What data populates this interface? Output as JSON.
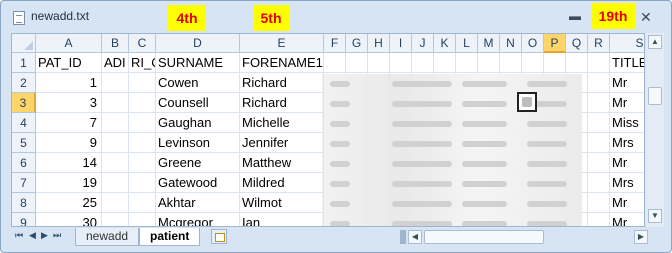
{
  "window": {
    "title": "newadd.txt"
  },
  "annotations": {
    "col4": "4th",
    "col5": "5th",
    "col19": "19th"
  },
  "colors": {
    "highlight": "#ffff00",
    "annotation_text": "#e30000",
    "selected_header": "#ffd56a"
  },
  "icons": {
    "doc": "document-icon",
    "minimize": "minimize-icon",
    "close": "close-icon"
  },
  "columns": [
    "A",
    "B",
    "C",
    "D",
    "E",
    "F",
    "G",
    "H",
    "I",
    "J",
    "K",
    "L",
    "M",
    "N",
    "O",
    "P",
    "Q",
    "R",
    "S"
  ],
  "selected": {
    "column": "P",
    "row": "3"
  },
  "row_numbers": [
    "1",
    "2",
    "3",
    "4",
    "5",
    "6",
    "7",
    "8",
    "9"
  ],
  "rows": [
    {
      "a": "PAT_ID",
      "b": "ADI",
      "c": "RI_C",
      "d": "SURNAME",
      "e": "FORENAME1",
      "s": "TITLE"
    },
    {
      "a": "1",
      "b": "",
      "c": "",
      "d": "Cowen",
      "e": "Richard",
      "s": "Mr"
    },
    {
      "a": "3",
      "b": "",
      "c": "",
      "d": "Counsell",
      "e": "Richard",
      "s": "Mr"
    },
    {
      "a": "7",
      "b": "",
      "c": "",
      "d": "Gaughan",
      "e": "Michelle",
      "s": "Miss"
    },
    {
      "a": "9",
      "b": "",
      "c": "",
      "d": "Levinson",
      "e": "Jennifer",
      "s": "Mrs"
    },
    {
      "a": "14",
      "b": "",
      "c": "",
      "d": "Greene",
      "e": "Matthew",
      "s": "Mr"
    },
    {
      "a": "19",
      "b": "",
      "c": "",
      "d": "Gatewood",
      "e": "Mildred",
      "s": "Mrs"
    },
    {
      "a": "25",
      "b": "",
      "c": "",
      "d": "Akhtar",
      "e": "Wilmot",
      "s": "Mr"
    },
    {
      "a": "30",
      "b": "",
      "c": "",
      "d": "Mcgregor",
      "e": "Ian",
      "s": "Mr"
    }
  ],
  "sheets": {
    "tab1": "newadd",
    "tab2": "patient",
    "active": "patient"
  }
}
